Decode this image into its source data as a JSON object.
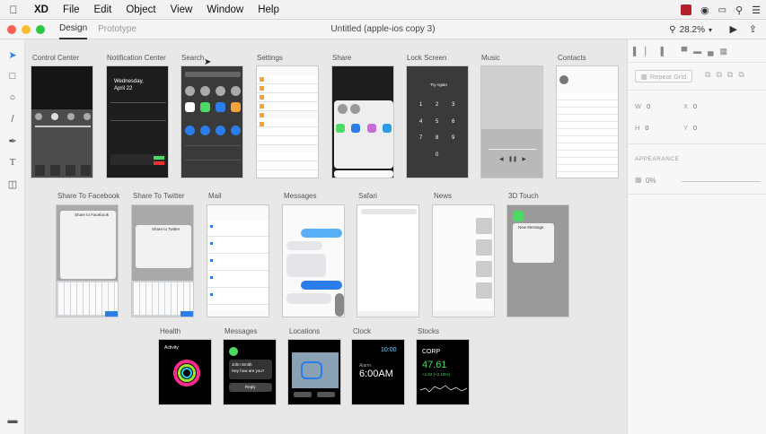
{
  "menubar": {
    "app": "XD",
    "items": [
      "File",
      "Edit",
      "Object",
      "View",
      "Window",
      "Help"
    ]
  },
  "titlebar": {
    "tabs": [
      "Design",
      "Prototype"
    ],
    "doc_title": "Untitled (apple-ios copy 3)",
    "zoom": "28.2%"
  },
  "artboards": [
    {
      "label": "Control Center"
    },
    {
      "label": "Notification Center",
      "date_line1": "Wednesday,",
      "date_line2": "April 22"
    },
    {
      "label": "Search"
    },
    {
      "label": "Settings"
    },
    {
      "label": "Share"
    },
    {
      "label": "Lock Screen",
      "title": "Try Again"
    },
    {
      "label": "Music"
    },
    {
      "label": "Contacts"
    },
    {
      "label": "Share To Facebook",
      "sheet": "Share to Facebook"
    },
    {
      "label": "Share To Twitter",
      "sheet": "Share to Twitter"
    },
    {
      "label": "Mail"
    },
    {
      "label": "Messages"
    },
    {
      "label": "Safari"
    },
    {
      "label": "News"
    },
    {
      "label": "3D Touch",
      "menu_title": "New Message"
    },
    {
      "label": "Health",
      "title": "Activity"
    },
    {
      "label": "Messages",
      "sender": "John Smith",
      "body": "Hey how are you?",
      "button": "Reply"
    },
    {
      "label": "Locations"
    },
    {
      "label": "Clock",
      "time_small": "10:00",
      "time_big": "6:00AM",
      "alarm": "Alarm"
    },
    {
      "label": "Stocks",
      "title": "CORP",
      "price": "47.61",
      "change": "+1.02 (+2.19%)"
    }
  ],
  "panel": {
    "repeat_grid": "Repeat Grid",
    "w_label": "W",
    "w_value": "0",
    "x_label": "X",
    "x_value": "0",
    "h_label": "H",
    "h_value": "0",
    "y_label": "Y",
    "y_value": "0",
    "appearance": "APPEARANCE",
    "opacity": "0%"
  },
  "colors": {
    "accent_blue": "#2b7de9",
    "traffic_red": "#fc5f57",
    "traffic_yellow": "#fdbc2e",
    "traffic_green": "#28c840",
    "ios_green": "#4cd964",
    "health_pink": "#ff2d8a"
  }
}
